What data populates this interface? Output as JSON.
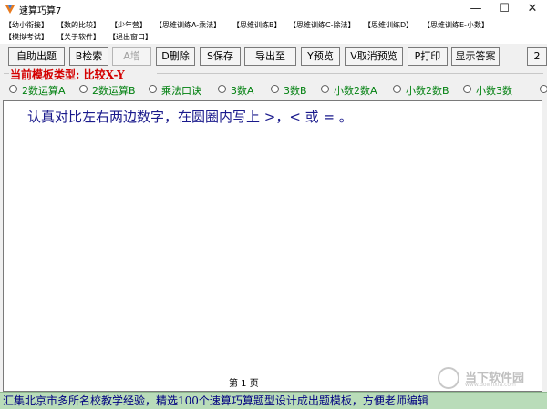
{
  "window": {
    "title": "速算巧算7",
    "minimize_glyph": "—",
    "maximize_glyph": "☐",
    "close_glyph": "✕"
  },
  "menu": {
    "row1": [
      "【幼小衔接】",
      "【数的比较】",
      "【少年营】",
      "【思维训练A-乘法】",
      "【思维训练B】",
      "【思维训练C-除法】",
      "【思维训练D】",
      "【思维训练E-小数】"
    ],
    "row2": [
      "【模拟考试】",
      "【关于软件】",
      "【退出窗口】"
    ]
  },
  "toolbar": {
    "buttons": [
      "自助出题",
      "B检索",
      "A增",
      "D删除",
      "S保存",
      "导出至",
      "Y预览",
      "V取消预览",
      "P打印",
      "显示答案"
    ],
    "extra_label": "2"
  },
  "template": {
    "label": "当前模板类型:  比较X-Y"
  },
  "radios": [
    "2数运算A",
    "2数运算B",
    "乘法口诀",
    "3数A",
    "3数B",
    "小数2数A",
    "小数2数B",
    "小数3数"
  ],
  "workspace": {
    "instruction": "认真对比左右两边数字，在圆圈内写上 >，< 或 = 。",
    "page": "第 1 页"
  },
  "status": {
    "text": "汇集北京市多所名校教学经验，精选100个速算巧算题型设计成出题模板，方便老师编辑"
  },
  "watermark": {
    "text": "当下软件园",
    "sub": "www.downxia.com"
  },
  "colors": {
    "template_label": "#d40000",
    "radio_label": "#00800f",
    "instruction": "#1a1a8c",
    "status_bg": "#b9dcb9",
    "status_text": "#000080"
  }
}
